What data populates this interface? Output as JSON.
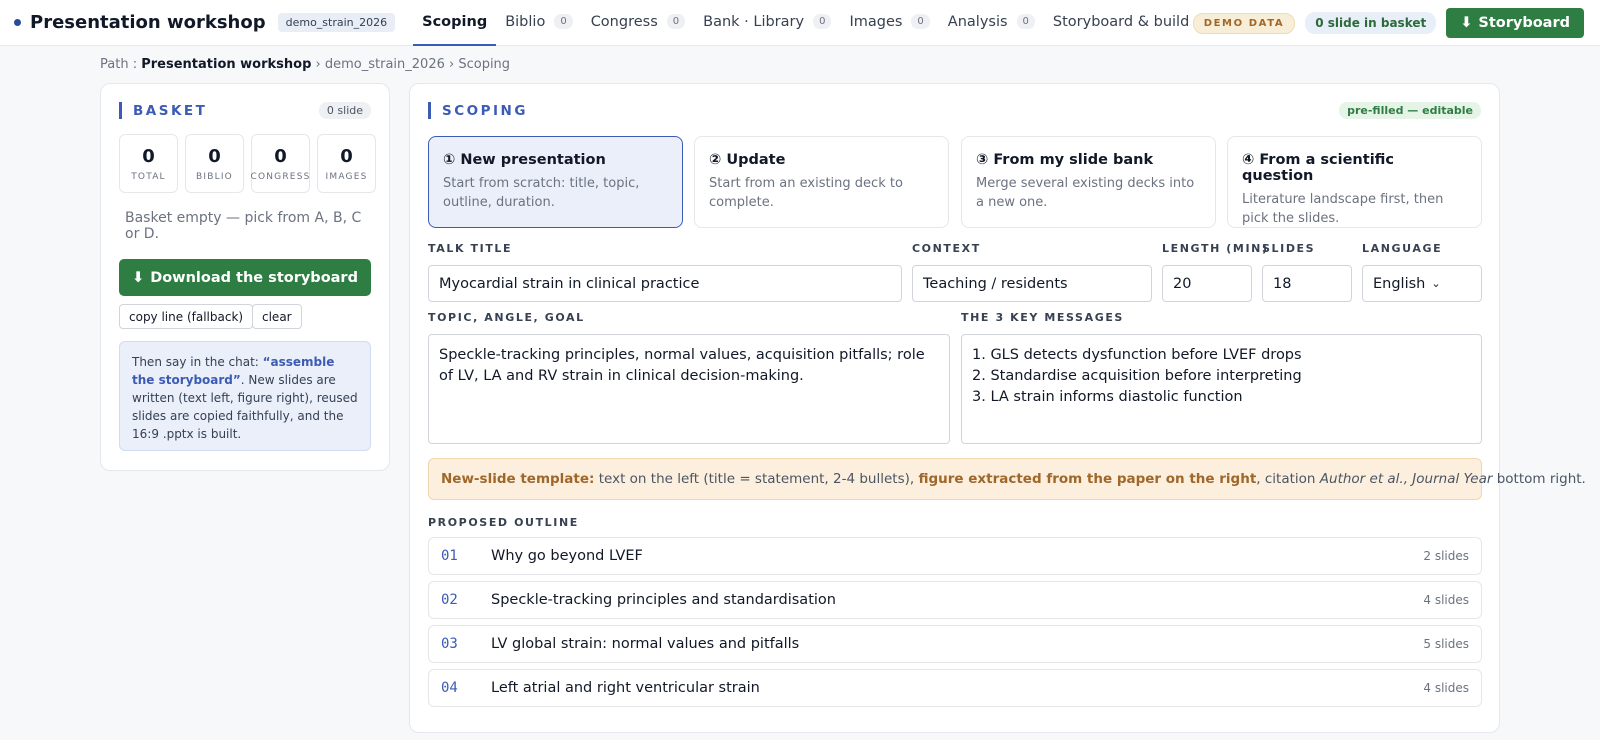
{
  "header": {
    "brand": "Presentation workshop",
    "project": "demo_strain_2026",
    "tabs": [
      {
        "label": "Scoping",
        "count": null
      },
      {
        "label": "Biblio",
        "count": "0"
      },
      {
        "label": "Congress",
        "count": "0"
      },
      {
        "label": "Bank · Library",
        "count": "0"
      },
      {
        "label": "Images",
        "count": "0"
      },
      {
        "label": "Analysis",
        "count": "0"
      },
      {
        "label": "Storyboard & build",
        "count": null
      }
    ],
    "demo_badge": "DEMO DATA",
    "basket_pill": "0 slide in basket",
    "storyboard_button": "Storyboard",
    "download_icon": "⬇"
  },
  "breadcrumb": {
    "prefix": "Path :",
    "root": "Presentation workshop",
    "sep": "›",
    "project": "demo_strain_2026",
    "current": "Scoping"
  },
  "basket": {
    "title": "BASKET",
    "slide_count": "0 slide",
    "stats": [
      {
        "value": "0",
        "label": "TOTAL"
      },
      {
        "value": "0",
        "label": "BIBLIO"
      },
      {
        "value": "0",
        "label": "CONGRESS"
      },
      {
        "value": "0",
        "label": "IMAGES"
      }
    ],
    "empty_message": "Basket empty — pick from A, B, C or D.",
    "download_button": "Download the storyboard",
    "copy_button": "copy line (fallback)",
    "clear_button": "clear",
    "info_prefix": "Then say in the chat: ",
    "info_quote": "“assemble the storyboard”",
    "info_suffix": ". New slides are written (text left, figure right), reused slides are copied faithfully, and the 16:9 .pptx is built."
  },
  "scoping": {
    "title": "SCOPING",
    "prefilled": "pre-filled — editable",
    "modes": [
      {
        "title": "① New presentation",
        "desc": "Start from scratch: title, topic, outline, duration.",
        "active": true
      },
      {
        "title": "② Update",
        "desc": "Start from an existing deck to complete.",
        "active": false
      },
      {
        "title": "③ From my slide bank",
        "desc": "Merge several existing decks into a new one.",
        "active": false
      },
      {
        "title": "④ From a scientific question",
        "desc": "Literature landscape first, then pick the slides.",
        "active": false
      }
    ],
    "fields": {
      "talk_title_label": "TALK TITLE",
      "talk_title": "Myocardial strain in clinical practice",
      "context_label": "CONTEXT",
      "context": "Teaching / residents",
      "length_label": "LENGTH (MIN)",
      "length": "20",
      "slides_label": "SLIDES",
      "slides": "18",
      "language_label": "LANGUAGE",
      "language": "English",
      "topic_label": "TOPIC, ANGLE, GOAL",
      "topic": "Speckle-tracking principles, normal values, acquisition pitfalls; role of LV, LA and RV strain in clinical decision-making.",
      "messages_label": "THE 3 KEY MESSAGES",
      "messages": [
        "1. GLS detects dysfunction before LVEF drops",
        "2. Standardise acquisition before interpreting",
        "3. LA strain informs diastolic function"
      ]
    },
    "template": {
      "label": "New-slide template:",
      "text1": " text on the left (title = statement, 2-4 bullets), ",
      "figure": "figure extracted from the paper on the right",
      "text2": ", citation ",
      "citation": "Author et al., Journal Year",
      "text3": " bottom right."
    },
    "outline_label": "PROPOSED OUTLINE",
    "outline": [
      {
        "num": "01",
        "title": "Why go beyond LVEF",
        "slides": "2 slides"
      },
      {
        "num": "02",
        "title": "Speckle-tracking principles and standardisation",
        "slides": "4 slides"
      },
      {
        "num": "03",
        "title": "LV global strain: normal values and pitfalls",
        "slides": "5 slides"
      },
      {
        "num": "04",
        "title": "Left atrial and right ventricular strain",
        "slides": "4 slides"
      }
    ]
  },
  "colors": {
    "accent": "#3b5bb5",
    "green": "#2e7d42",
    "template_bg": "#fcefdd"
  }
}
